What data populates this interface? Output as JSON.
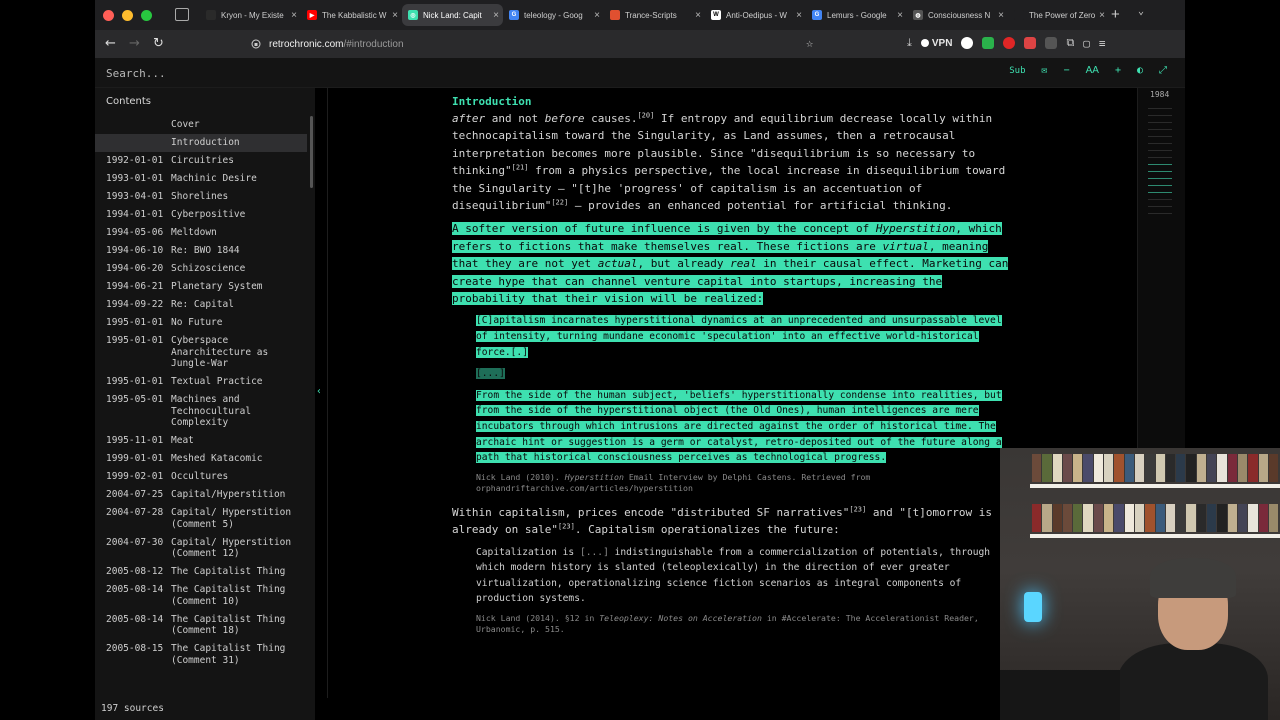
{
  "browser": {
    "tabs": [
      {
        "title": "Kryon - My Existe",
        "fav_color": "#2a2a2a",
        "fav_glyph": ""
      },
      {
        "title": "The Kabbalistic W",
        "fav_color": "#ff0000",
        "fav_glyph": "▶"
      },
      {
        "title": "Nick Land: Capit",
        "fav_color": "#3ee0b0",
        "fav_glyph": "◎",
        "active": true
      },
      {
        "title": "teleology - Goog",
        "fav_color": "#4285f4",
        "fav_glyph": "G"
      },
      {
        "title": "Trance-Scripts",
        "fav_color": "#e05030",
        "fav_glyph": ""
      },
      {
        "title": "Anti-Oedipus - W",
        "fav_color": "#ffffff",
        "fav_glyph": "W"
      },
      {
        "title": "Lemurs - Google",
        "fav_color": "#4285f4",
        "fav_glyph": "G"
      },
      {
        "title": "Consciousness N",
        "fav_color": "#555555",
        "fav_glyph": "◍"
      },
      {
        "title": "The Power of Zero -",
        "fav_color": "#1f1f21",
        "fav_glyph": ""
      }
    ],
    "url_host": "retrochronic.com",
    "url_path": "/#introduction",
    "vpn_label": "VPN"
  },
  "app": {
    "search_placeholder": "Search...",
    "sub_label": "Sub",
    "contents_label": "Contents",
    "sources_label": "197 sources",
    "minimap_year": "1984",
    "accent": "#3ee0b0"
  },
  "toc": [
    {
      "date": "",
      "title": "Cover"
    },
    {
      "date": "",
      "title": "Introduction",
      "active": true
    },
    {
      "date": "1992-01-01",
      "title": "Circuitries"
    },
    {
      "date": "1993-01-01",
      "title": "Machinic Desire"
    },
    {
      "date": "1993-04-01",
      "title": "Shorelines"
    },
    {
      "date": "1994-01-01",
      "title": "Cyberpositive"
    },
    {
      "date": "1994-05-06",
      "title": "Meltdown"
    },
    {
      "date": "1994-06-10",
      "title": "Re: BWO 1844"
    },
    {
      "date": "1994-06-20",
      "title": "Schizoscience"
    },
    {
      "date": "1994-06-21",
      "title": "Planetary System"
    },
    {
      "date": "1994-09-22",
      "title": "Re: Capital"
    },
    {
      "date": "1995-01-01",
      "title": "No Future"
    },
    {
      "date": "1995-01-01",
      "title": "Cyberspace Anarchitecture as Jungle-War"
    },
    {
      "date": "1995-01-01",
      "title": "Textual Practice"
    },
    {
      "date": "1995-05-01",
      "title": "Machines and Technocultural Complexity"
    },
    {
      "date": "1995-11-01",
      "title": "Meat"
    },
    {
      "date": "1999-01-01",
      "title": "Meshed Katacomic"
    },
    {
      "date": "1999-02-01",
      "title": "Occultures"
    },
    {
      "date": "2004-07-25",
      "title": "Capital/Hyperstition"
    },
    {
      "date": "2004-07-28",
      "title": "Capital/ Hyperstition (Comment 5)"
    },
    {
      "date": "2004-07-30",
      "title": "Capital/ Hyperstition (Comment 12)"
    },
    {
      "date": "2005-08-12",
      "title": "The Capitalist Thing"
    },
    {
      "date": "2005-08-14",
      "title": "The Capitalist Thing (Comment 10)"
    },
    {
      "date": "2005-08-14",
      "title": "The Capitalist Thing (Comment 18)"
    },
    {
      "date": "2005-08-15",
      "title": "The Capitalist Thing (Comment 31)"
    }
  ],
  "article": {
    "section_title": "Introduction",
    "p1_a": "after",
    "p1_b": " and not ",
    "p1_c": "before",
    "p1_d": " causes.",
    "p1_sup0": "[20]",
    "p1_e": " If entropy and equilibrium decrease locally within technocapitalism toward the Singularity, as Land assumes, then a retrocausal interpretation becomes more plausible. Since \"disequilibrium is so necessary to thinking\"",
    "p1_sup1": "[21]",
    "p1_f": " from a physics perspective, the local increase in disequilibrium toward the Singularity — \"[t]he 'progress' of capitalism is an accentuation of disequilibrium\"",
    "p1_sup2": "[22]",
    "p1_g": " — provides an enhanced potential for artificial thinking.",
    "p2_a": "A softer version of future influence is given by the concept of ",
    "p2_hyper": "Hyperstition",
    "p2_b": ", which refers to fictions that make themselves real. These fictions are ",
    "p2_virtual": "virtual",
    "p2_c": ", meaning that they are not yet ",
    "p2_actual": "actual",
    "p2_d": ", but already ",
    "p2_real": "real",
    "p2_e": " in their causal effect. Marketing can create hype that can channel venture capital into startups, increasing the probability that their vision will be realized:",
    "q1_a": "[C]apitalism incarnates hyperstitional dynamics at an unprecedented and unsurpassable level of intensity, turning mundane economic 'speculation' into an effective world-historical force.[.]",
    "q1_ellipsis": "[...]",
    "q1_b": "From the side of the human subject, 'beliefs' hyperstitionally condense into realities, but from the side of the hyperstitional object (the Old Ones), human intelligences are mere incubators through which intrusions are directed against the order of historical time. The archaic hint or suggestion is a germ or catalyst, retro-deposited out of the future along a path that historical consciousness perceives as technological progress.",
    "cite1_a": "Nick Land (2010). ",
    "cite1_ital": "Hyperstition",
    "cite1_b": " Email Interview by Delphi Castens. Retrieved from orphandriftarchive.com/articles/hyperstition",
    "p3_a": "Within capitalism, prices encode \"distributed SF narratives\"",
    "p3_sup1": "[23]",
    "p3_b": " and \"[t]omorrow is already on sale\"",
    "p3_sup2": "[23]",
    "p3_c": ". Capitalism operationalizes the future:",
    "q2_a": "Capitalization is ",
    "q2_dim": "[...]",
    "q2_b": " indistinguishable from a commercialization of potentials, through which modern history is slanted (teleoplexically) in the direction of ever greater virtualization, operationalizing science fiction scenarios as integral components of production systems.",
    "cite2_a": "Nick Land (2014). §12 in ",
    "cite2_ital": "Teleoplexy: Notes on Acceleration",
    "cite2_b": " in #Accelerate: The Accelerationist Reader, Urbanomic, p. 515."
  }
}
